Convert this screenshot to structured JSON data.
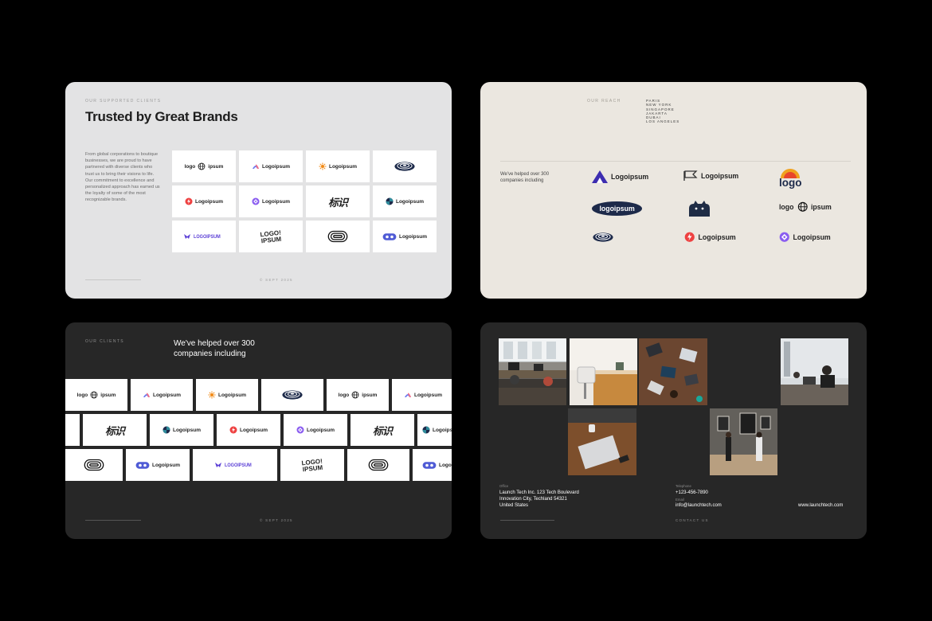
{
  "slide1": {
    "eyebrow": "OUR SUPPORTED CLIENTS",
    "title": "Trusted by Great Brands",
    "body": "From global corporations to boutique businesses, we are proud to have partnered with diverse clients who trust us to bring their visions to life. Our commitment to excellence and personalized approach has earned us the loyalty of some of the most recognizable brands.",
    "footer": "© SEPT 2025",
    "logos": [
      {
        "icon": "globe-icon",
        "text": "logo ipsum"
      },
      {
        "icon": "arch-icon",
        "text": "Logoipsum"
      },
      {
        "icon": "sun-icon",
        "text": "Logoipsum"
      },
      {
        "icon": "rings-icon",
        "text": ""
      },
      {
        "icon": "bolt-icon",
        "text": "Logoipsum"
      },
      {
        "icon": "diamond-icon",
        "text": "Logoipsum"
      },
      {
        "icon": "script-icon",
        "text": "标识"
      },
      {
        "icon": "swirl-icon",
        "text": "Logoipsum"
      },
      {
        "icon": "bird-icon",
        "text": "LOGOIPSUM"
      },
      {
        "icon": "burst-icon",
        "text": "LOGO! IPSUM"
      },
      {
        "icon": "maze-icon",
        "text": ""
      },
      {
        "icon": "pill-icon",
        "text": "Logoipsum"
      }
    ]
  },
  "slide2": {
    "eyebrow": "OUR REACH",
    "cities": [
      "PARIS",
      "NEW YORK",
      "SINGAPORE",
      "JAKARTA",
      "DUBAI",
      "LOS ANGELES"
    ],
    "lead": "We've helped over 300 companies including",
    "logos": [
      {
        "icon": "mountain-icon",
        "text": "Logoipsum"
      },
      {
        "icon": "flag-icon",
        "text": "Logoipsum"
      },
      {
        "icon": "sunrise-icon",
        "text": "logo"
      },
      {
        "icon": "oval-badge-icon",
        "text": "logoipsum"
      },
      {
        "icon": "cat-icon",
        "text": ""
      },
      {
        "icon": "globe-icon",
        "text": "logo ipsum"
      },
      {
        "icon": "rings-icon",
        "text": ""
      },
      {
        "icon": "bolt-icon",
        "text": "Logoipsum"
      },
      {
        "icon": "diamond-icon",
        "text": "Logoipsum"
      }
    ]
  },
  "slide3": {
    "eyebrow": "OUR CLIENTS",
    "lead": "We've helped over 300 companies including",
    "footer": "© SEPT 2025",
    "row1": [
      {
        "icon": "globe-icon",
        "text": "logo ipsum"
      },
      {
        "icon": "arch-icon",
        "text": "Logoipsum"
      },
      {
        "icon": "sun-icon",
        "text": "Logoipsum"
      },
      {
        "icon": "rings-icon",
        "text": ""
      },
      {
        "icon": "globe-icon",
        "text": "logo ipsum"
      },
      {
        "icon": "arch-icon",
        "text": "Logoipsum"
      }
    ],
    "row2": [
      {
        "icon": "none",
        "text": ""
      },
      {
        "icon": "script-icon",
        "text": "标识"
      },
      {
        "icon": "swirl-icon",
        "text": "Logoipsum"
      },
      {
        "icon": "bolt-icon",
        "text": "Logoipsum"
      },
      {
        "icon": "diamond-icon",
        "text": "Logoipsum"
      },
      {
        "icon": "script-icon",
        "text": "标识"
      },
      {
        "icon": "swirl-icon",
        "text": "Logoipsum"
      }
    ],
    "row3": [
      {
        "icon": "maze-icon",
        "text": ""
      },
      {
        "icon": "pill-icon",
        "text": "Logoipsum"
      },
      {
        "icon": "bird-icon",
        "text": "LOGOIPSUM"
      },
      {
        "icon": "burst-icon",
        "text": "LOGO! IPSUM"
      },
      {
        "icon": "maze-icon",
        "text": ""
      },
      {
        "icon": "pill-icon",
        "text": "Logoipsum"
      }
    ]
  },
  "slide4": {
    "office_label": "Office",
    "office": "Launch Tech Inc. 123 Tech Boulevard Innovation City, Techland 54321 United States",
    "telephone_label": "Telephone",
    "telephone": "+123-456-7890",
    "email_label": "Email",
    "email": "info@launchtech.com",
    "website": "www.launchtech.com",
    "footer": "CONTACT US"
  },
  "colors": {
    "purple": "#5b3fd6",
    "red": "#ee4141",
    "orange": "#f28a15",
    "navy": "#1d2a4a",
    "teal": "#2d8a9a",
    "light_slide": "#e3e3e4",
    "beige_slide": "#ebe7e0",
    "dark_slide": "#272727"
  }
}
